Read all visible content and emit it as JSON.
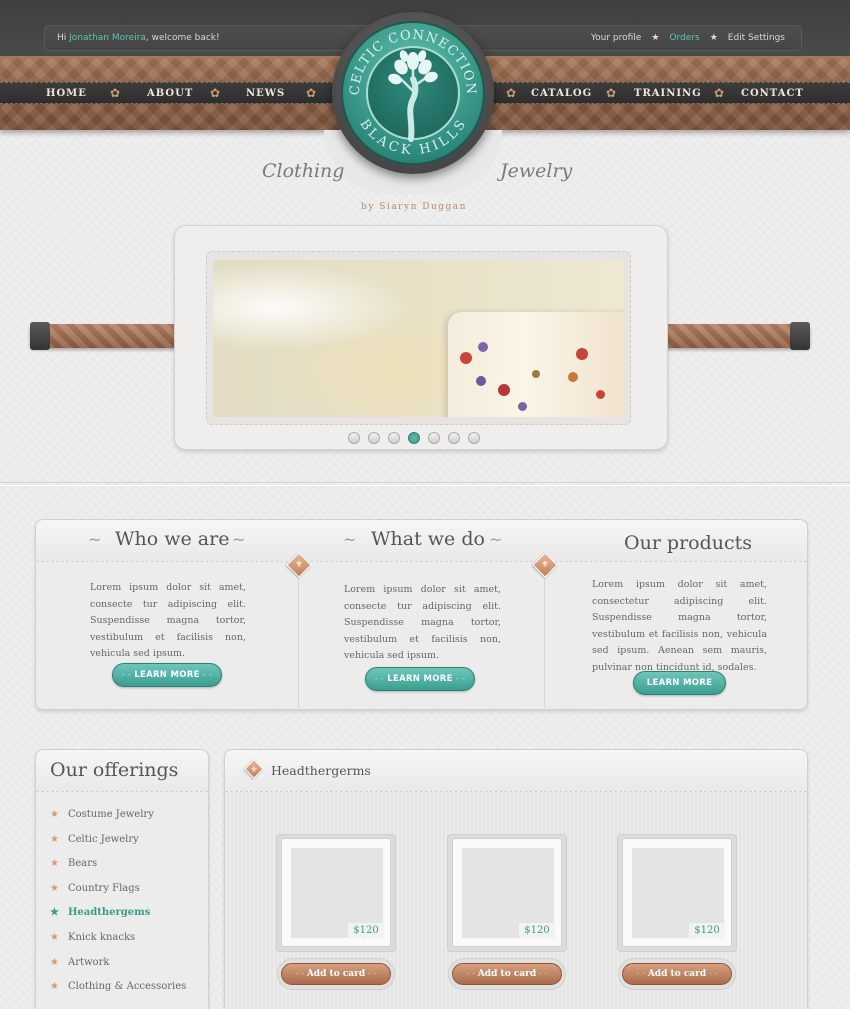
{
  "header": {
    "welcome_prefix": "Hi",
    "user_name": "Jonathan Moreira",
    "welcome_suffix": ", welcome back!",
    "links": {
      "profile": "Your profile",
      "orders": "Orders",
      "edit_settings": "Edit Settings"
    }
  },
  "nav": {
    "home": "HOME",
    "about": "ABOUT",
    "news": "NEWS",
    "catalog": "CATALOG",
    "training": "TRAINING",
    "contact": "CONTACT"
  },
  "logo": {
    "top_text": "CELTIC CONNECTION",
    "bottom_text": "BLACK HILLS"
  },
  "tagline": {
    "left": "Clothing",
    "right": "Jewelry",
    "by": "by Siaryn Duggan"
  },
  "slider": {
    "dot_count": 7,
    "active_index": 3
  },
  "info": [
    {
      "title": "Who we are",
      "text": "Lorem ipsum dolor sit amet, consecte tur adipiscing elit. Suspendisse magna tortor, vestibulum et facilisis non, vehicula sed ipsum.",
      "button": "LEARN MORE"
    },
    {
      "title": "What we do",
      "text": "Lorem ipsum dolor sit amet, consecte tur adipiscing elit. Suspendisse magna tortor, vestibulum et facilisis non, vehicula sed ipsum.",
      "button": "LEARN MORE"
    },
    {
      "title": "Our products",
      "text": "Lorem ipsum dolor sit amet, consectetur adipiscing elit. Suspendisse magna tortor, vestibulum et facilisis non, vehicula sed ipsum. Aenean sem mauris, pulvinar non tincidunt id, sodales.",
      "button": "LEARN MORE"
    }
  ],
  "offerings": {
    "title": "Our offerings",
    "items": [
      {
        "label": "Costume Jewelry",
        "active": false
      },
      {
        "label": "Celtic Jewelry",
        "active": false
      },
      {
        "label": "Bears",
        "active": false
      },
      {
        "label": "Country Flags",
        "active": false
      },
      {
        "label": "Headthergems",
        "active": true
      },
      {
        "label": "Knick knacks",
        "active": false
      },
      {
        "label": "Artwork",
        "active": false
      },
      {
        "label": "Clothing & Accessories",
        "active": false
      }
    ]
  },
  "products": {
    "title": "Headthergerms",
    "items": [
      {
        "price": "$120",
        "button": "Add to card"
      },
      {
        "price": "$120",
        "button": "Add to card"
      },
      {
        "price": "$120",
        "button": "Add to card"
      }
    ]
  },
  "colors": {
    "accent_teal": "#3a9a8d",
    "accent_copper": "#a86c4c",
    "header_dark": "#3f3f3f"
  }
}
